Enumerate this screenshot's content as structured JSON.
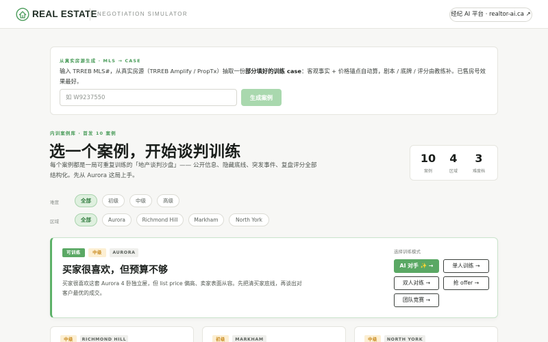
{
  "header": {
    "brand": "REAL ESTATE",
    "subtitle": "NEGOTIATION SIMULATOR",
    "platform_link": "经纪 AI 平台 · realtor-ai.ca ↗"
  },
  "generator": {
    "eyebrow": "从真实房源生成 · MLS → CASE",
    "desc_part1": "输入 TRREB MLS#，从真实房源（TRREB Amplify / PropTx）抽取一份",
    "desc_bold": "部分填好的训练 case",
    "desc_part2": "：客观事实 + 价格锚点自动算，剧本 / 底牌 / 评分由教练补。已售房号效果最好。",
    "input_placeholder": "如 W9237550",
    "button": "生成案例"
  },
  "library": {
    "eyebrow": "内训案例库 · 首发 10 案例",
    "title": "选一个案例，开始谈判训练",
    "desc": "每个案例都是一局可重复训练的「地产谈判沙盘」—— 公开信息、隐藏底线、突发事件、复盘评分全部结构化。先从 Aurora 这局上手。",
    "stats": [
      {
        "value": "10",
        "label": "案例"
      },
      {
        "value": "4",
        "label": "区域"
      },
      {
        "value": "3",
        "label": "难度档"
      }
    ]
  },
  "filters": {
    "difficulty_label": "难度",
    "difficulty": [
      "全部",
      "初级",
      "中级",
      "高级"
    ],
    "region_label": "区域",
    "region": [
      "全部",
      "Aurora",
      "Richmond Hill",
      "Markham",
      "North York"
    ]
  },
  "featured": {
    "tags": [
      "可训练",
      "中级",
      "AURORA"
    ],
    "title": "买家很喜欢，但预算不够",
    "desc": "买家很喜欢这套 Aurora 4 卧独立屋，但 list price 偏高、卖家表面从容。先把清买家底线，再谈出对客户最优的成交。",
    "mode_label": "选择训练模式",
    "modes": [
      "AI 对手 ✨ →",
      "单人训练 →",
      "双人对练 →",
      "抢 offer →",
      "团队竞赛 →"
    ]
  },
  "more_cards": [
    {
      "tags": [
        "中级",
        "RICHMOND HILL"
      ]
    },
    {
      "tags": [
        "初级",
        "MARKHAM"
      ]
    },
    {
      "tags": [
        "中级",
        "NORTH YORK"
      ]
    }
  ],
  "colors": {
    "accent": "#5aa864",
    "accent_light": "#a9d8ae",
    "tag_yellow_bg": "#fcefd3",
    "tag_yellow_text": "#c98a1e"
  }
}
